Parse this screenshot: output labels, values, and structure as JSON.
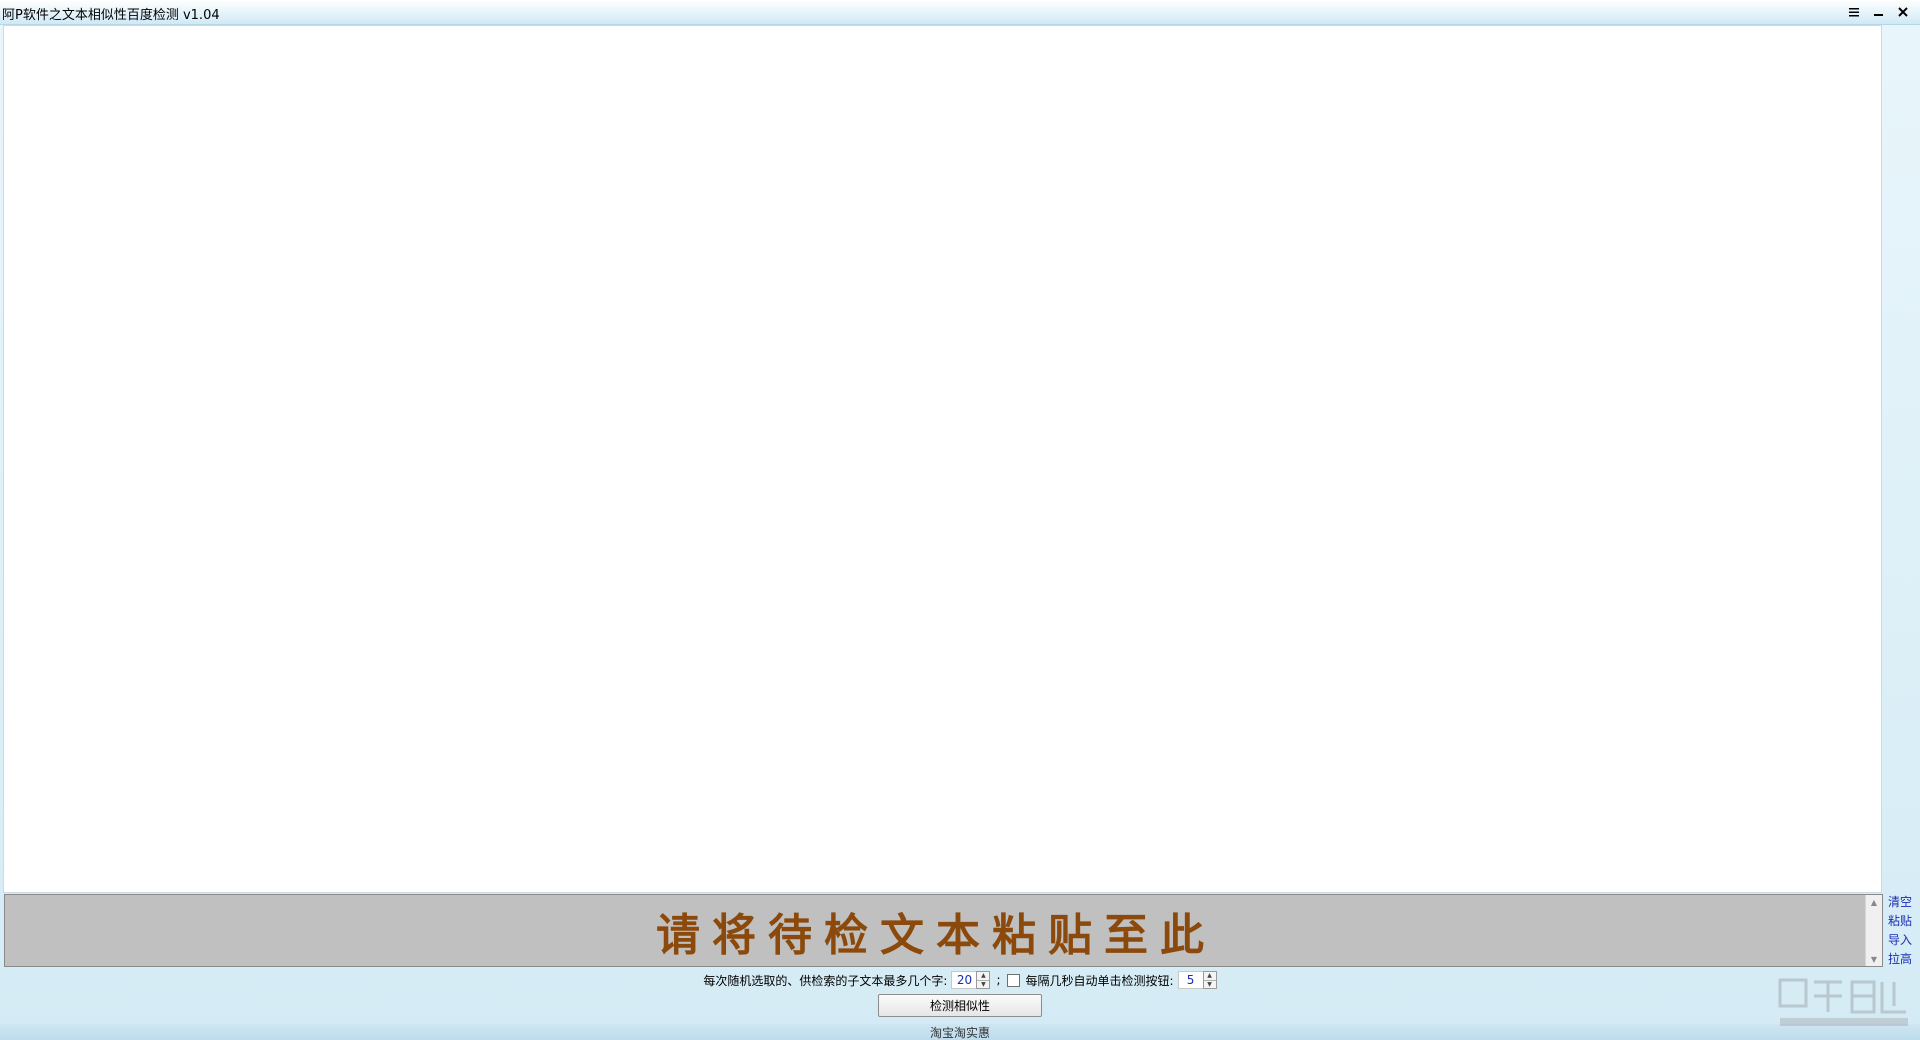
{
  "window": {
    "title": "阿P软件之文本相似性百度检测 v1.04"
  },
  "input": {
    "placeholder": "请将待检文本粘贴至此"
  },
  "side_links": [
    "清空",
    "粘贴",
    "导入",
    "拉高"
  ],
  "options": {
    "max_chars_label": "每次随机选取的、供检索的子文本最多几个字:",
    "max_chars_value": "20",
    "separator": ";",
    "auto_click_label": "每隔几秒自动单击检测按钮:",
    "auto_click_value": "5",
    "auto_click_checked": false
  },
  "actions": {
    "check_label": "检测相似性"
  },
  "status": {
    "link_label": "淘宝淘实惠"
  },
  "colors": {
    "placeholder_color": "#8b4a0c",
    "link_color": "#1b2db4",
    "input_bg": "#c0c0c0"
  }
}
